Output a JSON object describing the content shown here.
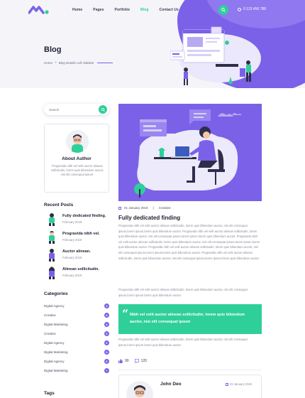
{
  "nav": {
    "items": [
      {
        "label": "Home"
      },
      {
        "label": "Pages"
      },
      {
        "label": "Portfolio"
      },
      {
        "label": "Blog"
      },
      {
        "label": "Contact Us"
      }
    ],
    "active": "Blog",
    "phone": "0 123 456 788"
  },
  "header": {
    "title": "Blog",
    "breadcrumb": {
      "home": "Home",
      "separator": "»",
      "current": "Blog Details Left Sidebar"
    }
  },
  "sidebar": {
    "search_placeholder": "Search",
    "author": {
      "title": "About Author",
      "description": "Progravida nibh vel velit auctor alinean sollicitudin, lorem quis bibendum auctor, nisi elit consequat ipsum."
    },
    "recent_posts_title": "Recent Posts",
    "recent_posts": [
      {
        "title": "Fully dedicated finding.",
        "date": "February 2019"
      },
      {
        "title": "Progravida nibh vel.",
        "date": "February 2019"
      },
      {
        "title": "Auctor alinean.",
        "date": "February 2019"
      },
      {
        "title": "Alinean sollicitudin.",
        "date": "February 2019"
      }
    ],
    "categories_title": "Categories",
    "categories": [
      {
        "label": "Digital Agency",
        "count": "6"
      },
      {
        "label": "Creative",
        "count": "6"
      },
      {
        "label": "Digital Marketing",
        "count": "6"
      },
      {
        "label": "Creative",
        "count": "6"
      },
      {
        "label": "Digital Agency",
        "count": "6"
      },
      {
        "label": "Digital Marketing",
        "count": "6"
      },
      {
        "label": "Digital Agency",
        "count": "6"
      },
      {
        "label": "Digital Marketing",
        "count": "7"
      }
    ],
    "tags_title": "Tags"
  },
  "post": {
    "date": "01 January 2019",
    "divider": "|",
    "category": "Creative",
    "title": "Fully dedicated finding",
    "paragraph1": "Progravida nibh vel velit auctor alinean sollicitudin, lorem quis bibendum auctor, nisi elit consequat ipsum,lorem ipsum.lorem quis bibendum auctor. Progravida nibh vel velit auctor alinean sollicitudin, lorem quis bibendum auctor, nisi elit consequat ipsum.lorem ipsum.lorem quis bibendum auctor. Progravida nibh vel velit auctor alinean sollicitudin, lorem quis bibendum auctor, nisi elit consequat ipsum,lorem ipsum.lorem quis bibendum auctor. Progravida nibh vel velit auctor alinean sollicitudin, lorem quis bibendum auctor, nisi elit consequat ipsum,lorem ipsum.lorem quis bibendum auctor. Progravida nibh vel velit auctor alinean sollicitudin, lorem quis bibendum auctor, nisi elit consequat ipsum,lorem ipsum.lorem quis bibendum auctor.",
    "paragraph2": "Progravida nibh vel velit auctor alinean sollicitudin, lorem quis bibendum auctor, nisi elit consequat ipsum,lorem ipsum.lorem quis bibendum auctor.",
    "quote": "Nibh vel velit auctor alinean sollicitudin, lorem quis bibendum auctor, nisi elit consequat ipsum",
    "paragraph3": "Progravida nibh vel velit auctor alinean sollicitudin, lorem quis bibendum auctor, nisi elit consequat ipsum,lorem ipsum.lorem quis bibendum auctor.",
    "likes": "90",
    "comments": "120",
    "author_name": "John Deo",
    "author_date": "01 January 2019"
  },
  "colors": {
    "accent": "#7b61e8",
    "green": "#2fcf9a"
  }
}
